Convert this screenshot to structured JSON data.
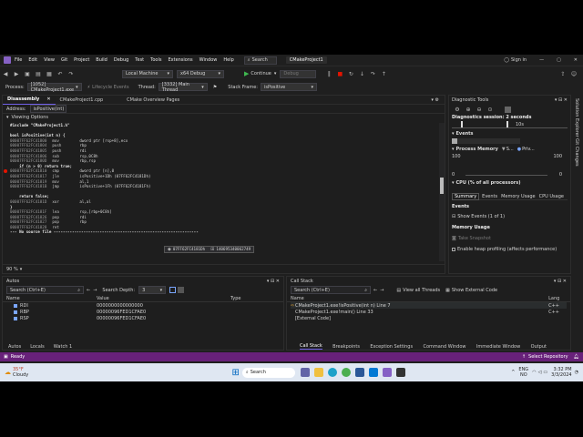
{
  "title": {
    "menu": [
      "File",
      "Edit",
      "View",
      "Git",
      "Project",
      "Build",
      "Debug",
      "Test",
      "Tools",
      "Extensions",
      "Window",
      "Help"
    ],
    "search": "Search",
    "project": "CMakeProject1",
    "sign_in": "Sign in"
  },
  "toolbar": {
    "local_machine": "Local Machine",
    "config": "x64 Debug",
    "continue": "Continue",
    "debug_target": "Debug"
  },
  "debug_bar": {
    "process_label": "Process:",
    "process_value": "[1052] CMakeProject1.exe",
    "lifecycle": "Lifecycle Events",
    "thread_label": "Thread:",
    "thread_value": "[3332] Main Thread",
    "stack_label": "Stack Frame:",
    "stack_value": "isPositive"
  },
  "editor": {
    "tabs": [
      "Disassembly",
      "CMakeProject1.cpp",
      "CMake Overview Pages"
    ],
    "address_label": "Address:",
    "address_value": "isPositive(int)",
    "viewing_options": "Viewing Options",
    "lines": [
      {
        "t": "#include \"CMakeProject1.h\""
      },
      {
        "t": ""
      },
      {
        "t": "bool isPositive(int n) {"
      },
      {
        "a": "00007FF62FC41800",
        "o": "mov",
        "x": "dword ptr [rsp+8],ecx"
      },
      {
        "a": "00007FF62FC41804",
        "o": "push",
        "x": "rbp"
      },
      {
        "a": "00007FF62FC41805",
        "o": "push",
        "x": "rdi"
      },
      {
        "a": "00007FF62FC41806",
        "o": "sub",
        "x": "rsp,0C8h"
      },
      {
        "a": "00007FF62FC4180D",
        "o": "mov",
        "x": "rbp,rsp"
      },
      {
        "t": "    if (n > 0) return true;"
      },
      {
        "a": "00007FF62FC41810",
        "o": "cmp",
        "x": "dword ptr [n],0"
      },
      {
        "a": "00007FF62FC41817",
        "o": "jle",
        "x": "isPositive+1Dh (07FF62FC4181Dh)"
      },
      {
        "a": "00007FF62FC41819",
        "o": "mov",
        "x": "al,1"
      },
      {
        "a": "00007FF62FC4181B",
        "o": "jmp",
        "x": "isPositive+1Fh (07FF62FC4181Fh)"
      },
      {
        "t": ""
      },
      {
        "t": "    return false;"
      },
      {
        "a": "00007FF62FC4181D",
        "o": "xor",
        "x": "al,al"
      },
      {
        "t": "}"
      },
      {
        "a": "00007FF62FC4181F",
        "o": "lea",
        "x": "rsp,[rbp+0C8h]"
      },
      {
        "a": "00007FF62FC41826",
        "o": "pop",
        "x": "rdi"
      },
      {
        "a": "00007FF62FC41827",
        "o": "pop",
        "x": "rbp"
      },
      {
        "a": "00007FF62FC41828",
        "o": "ret",
        "x": ""
      },
      {
        "t": "--- No source file ---------------------------------------------------------------"
      }
    ],
    "tooltip_addr": "07FF62FC4181Dh",
    "tooltip_value": "140695340062749",
    "zoom": "90 %"
  },
  "diag": {
    "title": "Diagnostic Tools",
    "session": "Diagnostics session: 2 seconds",
    "time_tick": "10s",
    "events": "Events",
    "process_memory": "Process Memory",
    "snap": "S...",
    "priv": "Priv...",
    "y_top": "100",
    "y_bottom": "0",
    "cpu": "CPU (% of all processors)",
    "tabs": [
      "Summary",
      "Events",
      "Memory Usage",
      "CPU Usage"
    ],
    "events_hdr": "Events",
    "show_events": "Show Events (1 of 1)",
    "mem_usage": "Memory Usage",
    "snapshot": "Take Snapshot",
    "heap": "Enable heap profiling (affects performance)"
  },
  "right_rail": [
    "Solution Explorer",
    "Git Changes"
  ],
  "autos": {
    "title": "Autos",
    "search": "Search (Ctrl+E)",
    "depth_label": "Search Depth:",
    "depth_value": "3",
    "cols": [
      "Name",
      "Value",
      "Type"
    ],
    "rows": [
      {
        "name": "RDI",
        "value": "0000000000000000"
      },
      {
        "name": "RBP",
        "value": "00000096FED1CFAE0"
      },
      {
        "name": "RSP",
        "value": "00000096FED1CFAE0"
      }
    ],
    "tabs": [
      "Autos",
      "Locals",
      "Watch 1"
    ]
  },
  "callstack": {
    "title": "Call Stack",
    "search": "Search (Ctrl+E)",
    "view_all": "View all Threads",
    "show_external": "Show External Code",
    "cols": [
      "Name",
      "Lang"
    ],
    "rows": [
      {
        "name": "CMakeProject1.exe!isPositive(int n) Line 7",
        "lang": "C++"
      },
      {
        "name": "CMakeProject1.exe!main() Line 33",
        "lang": "C++"
      },
      {
        "name": "[External Code]",
        "lang": ""
      }
    ],
    "tabs": [
      "Call Stack",
      "Breakpoints",
      "Exception Settings",
      "Command Window",
      "Immediate Window",
      "Output"
    ]
  },
  "status": {
    "ready": "Ready",
    "repo": "Select Repository"
  },
  "taskbar": {
    "temp": "35°F",
    "weather": "Cloudy",
    "search": "Search",
    "lang": "ENG",
    "region": "NO",
    "time": "3:32 PM",
    "date": "3/3/2024"
  },
  "colors": {
    "accent": "#7160e8",
    "status": "#68217a",
    "continue": "#3fb950",
    "breakpoint": "#e51400"
  }
}
